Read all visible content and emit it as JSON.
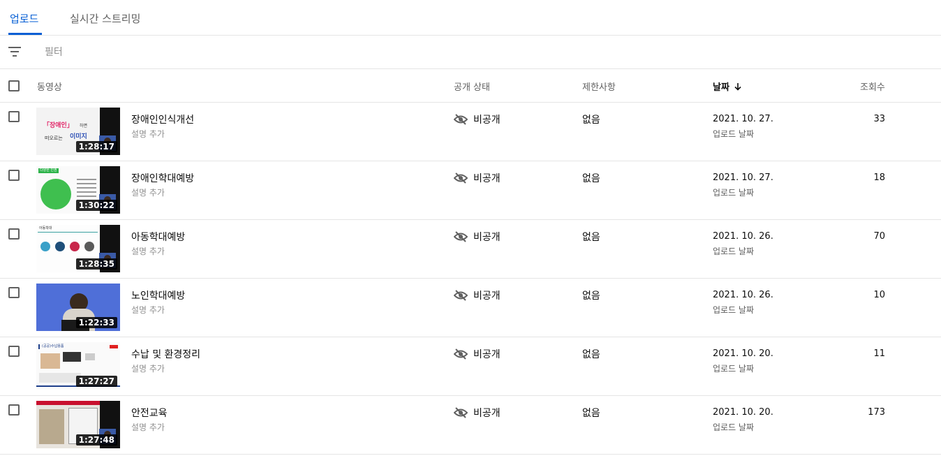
{
  "tabs": [
    {
      "label": "업로드",
      "active": true
    },
    {
      "label": "실시간 스트리밍",
      "active": false
    }
  ],
  "filter": {
    "icon": "filter-icon",
    "placeholder": "필터"
  },
  "columns": {
    "video": "동영상",
    "visibility": "공개 상태",
    "restrictions": "제한사항",
    "date": "날짜",
    "views": "조회수",
    "sorted_by": "date",
    "sort_direction": "descending"
  },
  "colors": {
    "accent": "#065fd4",
    "border": "#e5e5e5",
    "secondary_text": "#606060"
  },
  "thumb_text": {
    "row1_line1": "「장애인」",
    "row1_line1_suffix": "하면",
    "row1_line2": "떠오르는",
    "row1_line2_accent": "이미지",
    "row2_heading": "다양한 인권",
    "row3_heading": "아동학대",
    "row5_heading": "(공공)수납용품"
  },
  "videos": [
    {
      "title": "장애인인식개선",
      "description": "설명 추가",
      "duration": "1:28:17",
      "visibility": "비공개",
      "restrictions": "없음",
      "date": "2021. 10. 27.",
      "date_label": "업로드 날짜",
      "views": "33"
    },
    {
      "title": "장애인학대예방",
      "description": "설명 추가",
      "duration": "1:30:22",
      "visibility": "비공개",
      "restrictions": "없음",
      "date": "2021. 10. 27.",
      "date_label": "업로드 날짜",
      "views": "18"
    },
    {
      "title": "아동학대예방",
      "description": "설명 추가",
      "duration": "1:28:35",
      "visibility": "비공개",
      "restrictions": "없음",
      "date": "2021. 10. 26.",
      "date_label": "업로드 날짜",
      "views": "70"
    },
    {
      "title": "노인학대예방",
      "description": "설명 추가",
      "duration": "1:22:33",
      "visibility": "비공개",
      "restrictions": "없음",
      "date": "2021. 10. 26.",
      "date_label": "업로드 날짜",
      "views": "10"
    },
    {
      "title": "수납 및 환경정리",
      "description": "설명 추가",
      "duration": "1:27:27",
      "visibility": "비공개",
      "restrictions": "없음",
      "date": "2021. 10. 20.",
      "date_label": "업로드 날짜",
      "views": "11"
    },
    {
      "title": "안전교육",
      "description": "설명 추가",
      "duration": "1:27:48",
      "visibility": "비공개",
      "restrictions": "없음",
      "date": "2021. 10. 20.",
      "date_label": "업로드 날짜",
      "views": "173"
    }
  ]
}
